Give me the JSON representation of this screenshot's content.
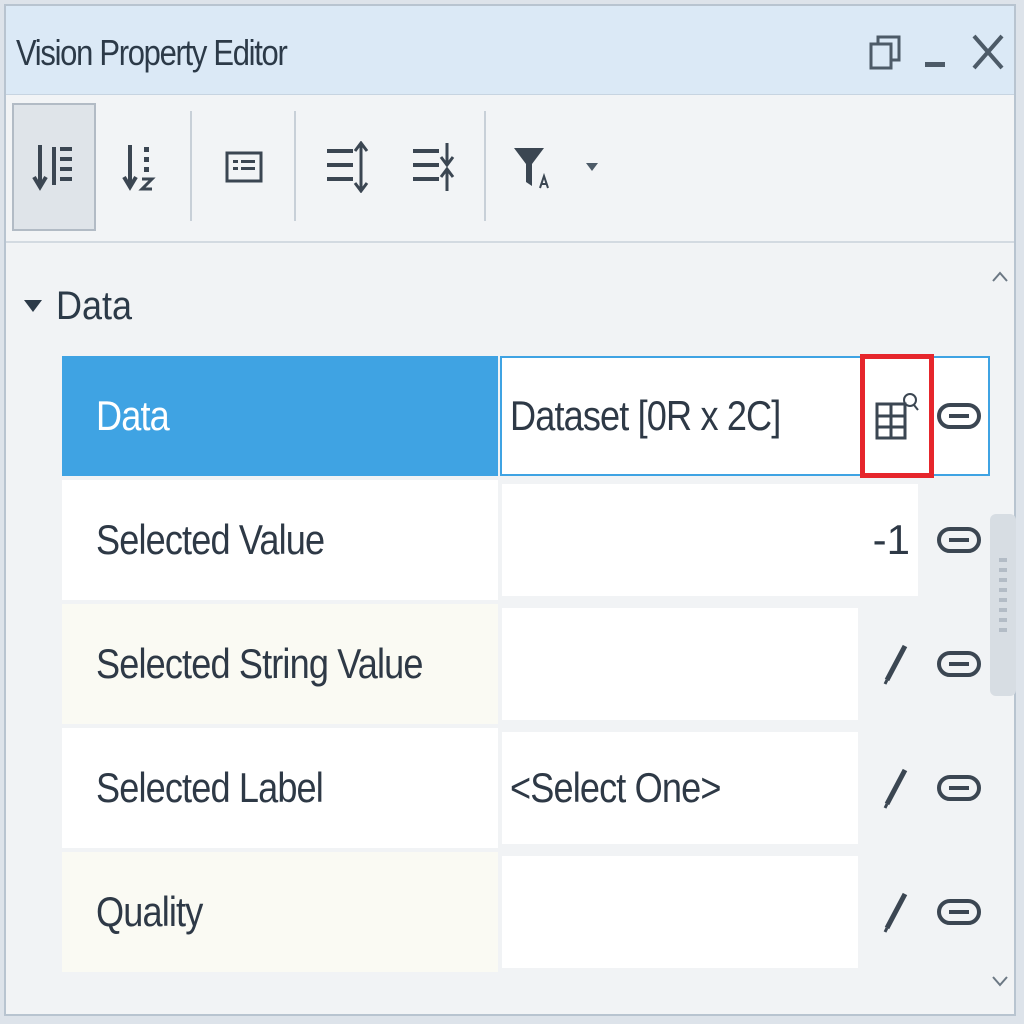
{
  "window": {
    "title": "Vision Property Editor"
  },
  "toolbar": {
    "buttons": [
      {
        "name": "sort-categorized",
        "icon": "sort-categorized-icon",
        "active": true
      },
      {
        "name": "sort-alphabetical",
        "icon": "sort-alphabetical-icon",
        "active": false
      },
      {
        "name": "property-pages",
        "icon": "property-pages-icon",
        "active": false
      },
      {
        "name": "expand-all",
        "icon": "expand-all-icon",
        "active": false
      },
      {
        "name": "collapse-all",
        "icon": "collapse-all-icon",
        "active": false
      },
      {
        "name": "filter",
        "icon": "filter-icon",
        "active": false
      }
    ]
  },
  "section": {
    "label": "Data",
    "expanded": true
  },
  "properties": [
    {
      "name": "Data",
      "value": "Dataset [0R x 2C]",
      "selected": true
    },
    {
      "name": "Selected Value",
      "value": "-1"
    },
    {
      "name": "Selected String Value",
      "value": ""
    },
    {
      "name": "Selected Label",
      "value": "<Select One>"
    },
    {
      "name": "Quality",
      "value": ""
    }
  ],
  "colors": {
    "selection": "#3fa3e3",
    "highlight_border": "#e6262c",
    "titlebar": "#dbe9f6"
  }
}
